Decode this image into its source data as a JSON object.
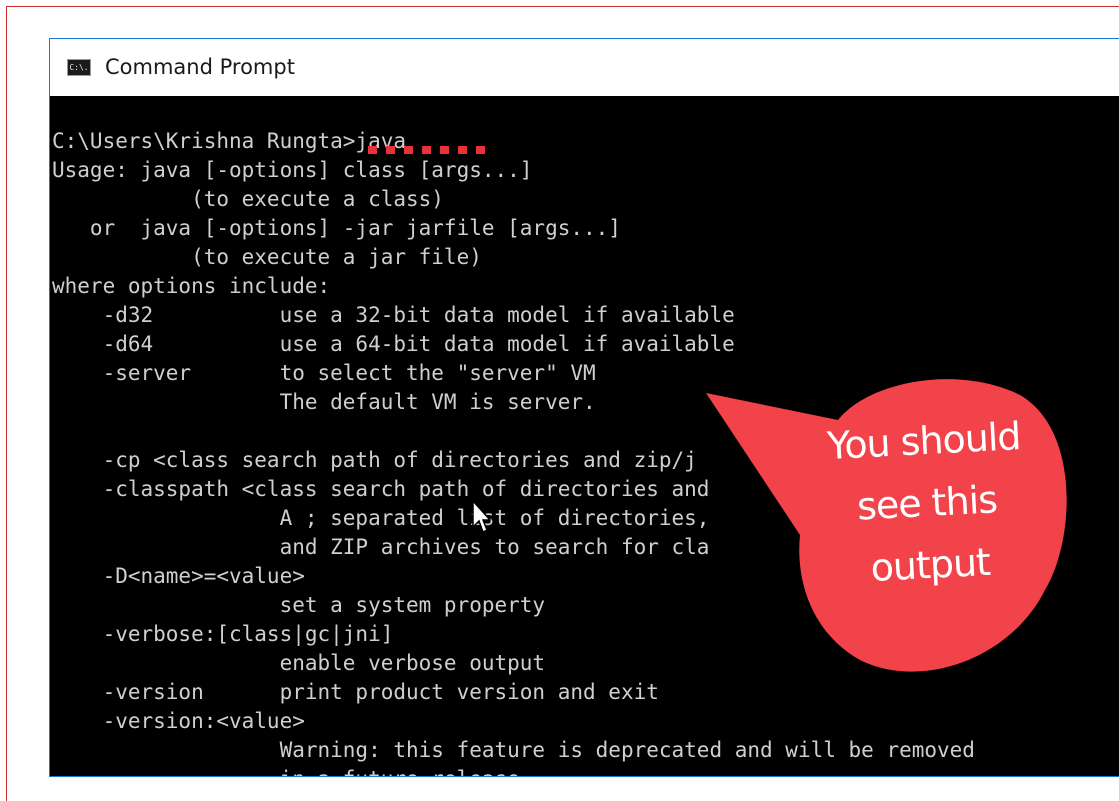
{
  "window": {
    "title": "Command Prompt",
    "icon_label": "C:\\."
  },
  "console": {
    "lines": [
      "C:\\Users\\Krishna Rungta>java",
      "Usage: java [-options] class [args...]",
      "           (to execute a class)",
      "   or  java [-options] -jar jarfile [args...]",
      "           (to execute a jar file)",
      "where options include:",
      "    -d32          use a 32-bit data model if available",
      "    -d64          use a 64-bit data model if available",
      "    -server       to select the \"server\" VM",
      "                  The default VM is server.",
      "",
      "    -cp <class search path of directories and zip/j",
      "    -classpath <class search path of directories and",
      "                  A ; separated list of directories,",
      "                  and ZIP archives to search for cla",
      "    -D<name>=<value>",
      "                  set a system property",
      "    -verbose:[class|gc|jni]",
      "                  enable verbose output",
      "    -version      print product version and exit",
      "    -version:<value>",
      "                  Warning: this feature is deprecated and will be removed",
      "                  in a future release"
    ]
  },
  "annotation": {
    "callout_text": "You should see this output",
    "callout_lines": [
      "You should",
      "see this",
      "output"
    ],
    "callout_color": "#f2424a",
    "marker_color": "#e8323a"
  },
  "colors": {
    "frame_border": "#c9302c",
    "window_border": "#1e74d8",
    "console_bg": "#000000",
    "console_fg": "#cfcfcf"
  }
}
